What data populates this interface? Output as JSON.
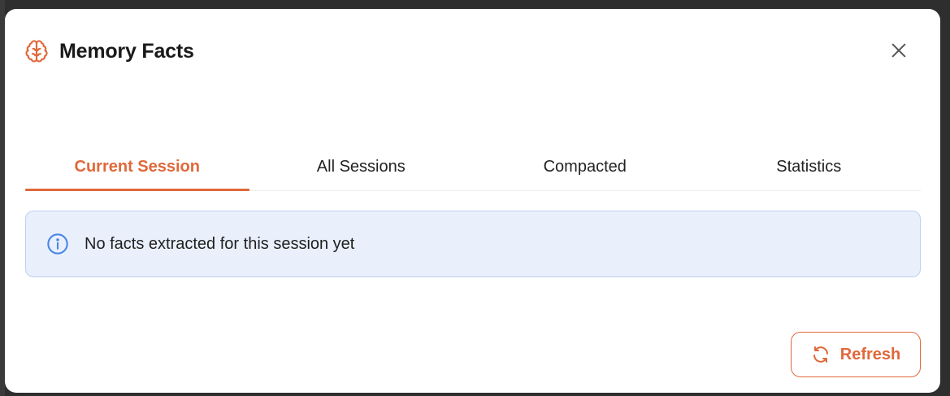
{
  "modal": {
    "title": "Memory Facts",
    "title_icon": "brain-icon",
    "close_icon": "close-icon"
  },
  "tabs": [
    {
      "label": "Current Session",
      "active": true
    },
    {
      "label": "All Sessions",
      "active": false
    },
    {
      "label": "Compacted",
      "active": false
    },
    {
      "label": "Statistics",
      "active": false
    }
  ],
  "alert": {
    "icon": "info-icon",
    "message": "No facts extracted for this session yet"
  },
  "footer": {
    "refresh_label": "Refresh",
    "refresh_icon": "refresh-icon"
  },
  "colors": {
    "accent": "#e0683a",
    "info_bg": "#e9f0fc",
    "info_border": "#bcd0f0",
    "info_icon": "#4a86e8"
  }
}
